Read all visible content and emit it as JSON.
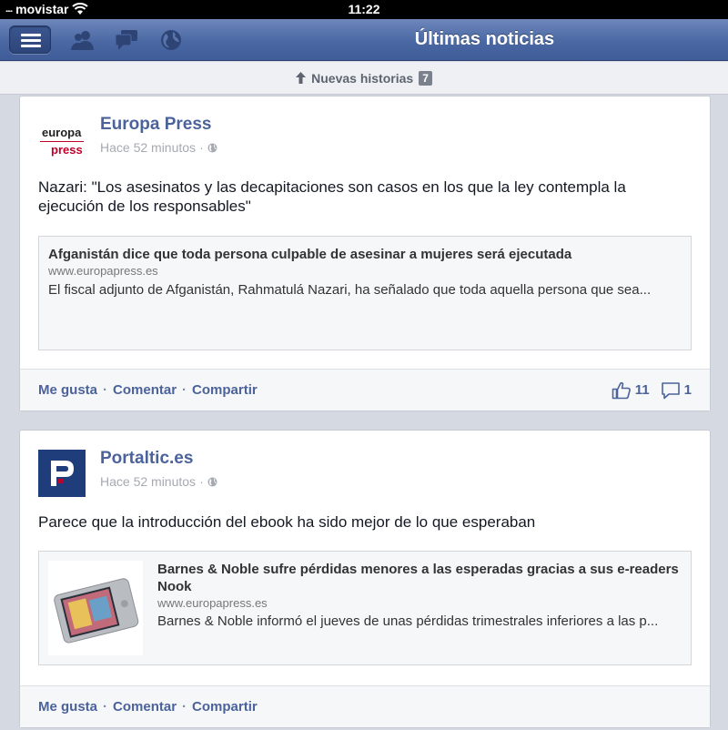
{
  "status_bar": {
    "signal": "....",
    "carrier": "movistar",
    "time": "11:22"
  },
  "nav": {
    "title": "Últimas noticias",
    "icons": [
      "menu-icon",
      "friends-icon",
      "messages-icon",
      "globe-icon"
    ]
  },
  "new_stories": {
    "label": "Nuevas historias",
    "count": "7"
  },
  "stories": [
    {
      "source": "Europa Press",
      "logo_text": [
        "europa",
        "press"
      ],
      "time": "Hace 52 minutos",
      "message": "Nazari: \"Los asesinatos y las decapitaciones son casos en los que la ley contempla la ejecución de los responsables\"",
      "link": {
        "title": "Afganistán dice que toda persona culpable de asesinar a mujeres será ejecutada",
        "domain": "www.europapress.es",
        "description": "El fiscal adjunto de Afganistán, Rahmatulá Nazari, ha señalado que toda aquella persona que sea..."
      },
      "actions": {
        "like": "Me gusta",
        "comment": "Comentar",
        "share": "Compartir"
      },
      "likes": "11",
      "comments": "1"
    },
    {
      "source": "Portaltic.es",
      "time": "Hace 52 minutos",
      "message": "Parece que la introducción del ebook ha sido mejor de lo que esperaban",
      "link": {
        "title": "Barnes & Noble sufre pérdidas menores a las esperadas gracias a sus e-readers Nook",
        "domain": "www.europapress.es",
        "description": "Barnes & Noble informó el jueves de unas pérdidas trimestrales inferiores a las p..."
      },
      "actions": {
        "like": "Me gusta",
        "comment": "Comentar",
        "share": "Compartir"
      }
    }
  ],
  "colors": {
    "nav_blue": "#4a68a3",
    "link_blue": "#4b629b",
    "europa_red": "#c1002a",
    "portaltic_blue": "#1f3d7a"
  }
}
